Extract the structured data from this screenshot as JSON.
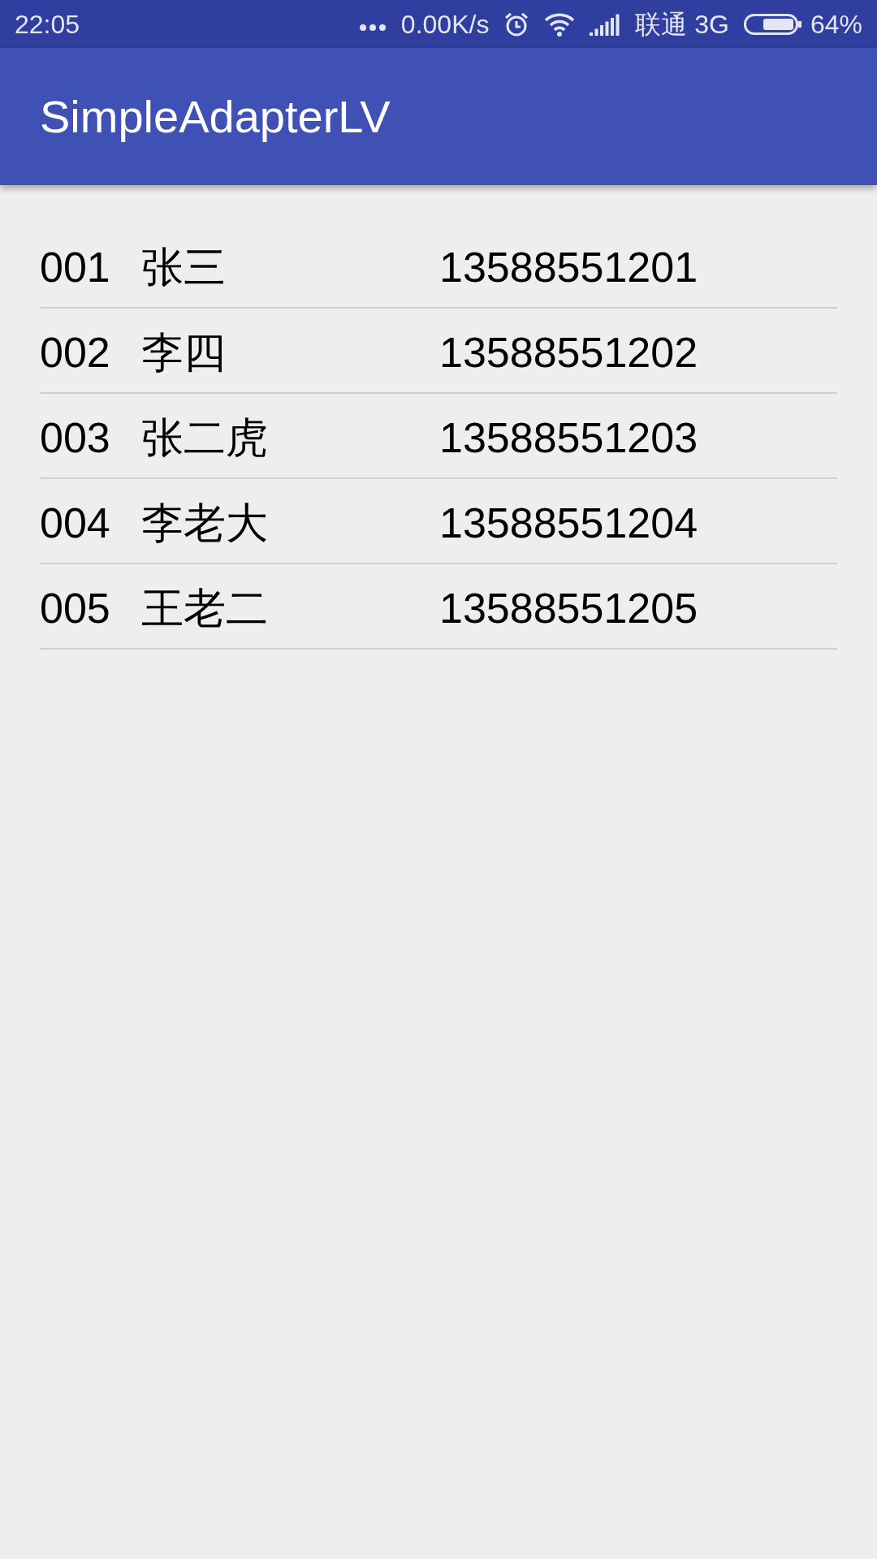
{
  "status_bar": {
    "time": "22:05",
    "net_speed": "0.00K/s",
    "carrier": "联通 3G",
    "battery": "64%"
  },
  "app_bar": {
    "title": "SimpleAdapterLV"
  },
  "list": [
    {
      "id": "001",
      "name": "张三",
      "phone": "13588551201"
    },
    {
      "id": "002",
      "name": "李四",
      "phone": "13588551202"
    },
    {
      "id": "003",
      "name": "张二虎",
      "phone": "13588551203"
    },
    {
      "id": "004",
      "name": "李老大",
      "phone": "13588551204"
    },
    {
      "id": "005",
      "name": "王老二",
      "phone": "13588551205"
    }
  ]
}
